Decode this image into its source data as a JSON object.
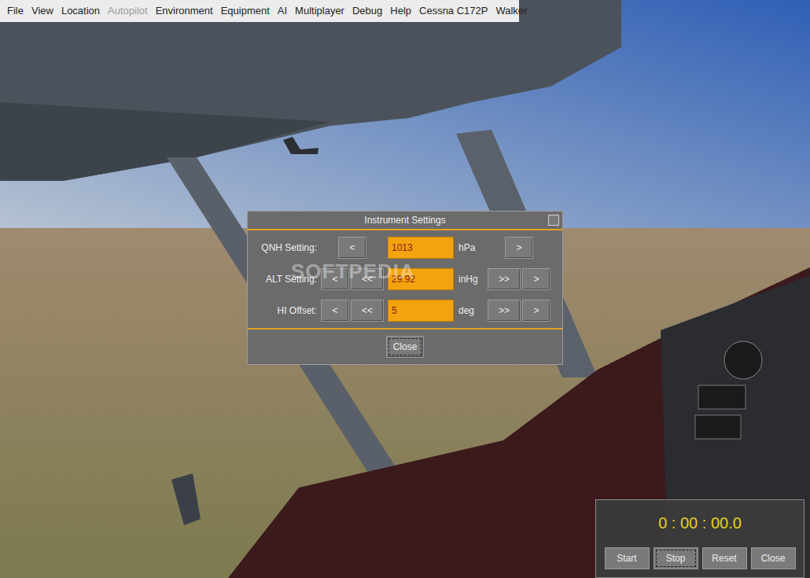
{
  "menu_bar": {
    "items": [
      {
        "label": "File",
        "disabled": false
      },
      {
        "label": "View",
        "disabled": false
      },
      {
        "label": "Location",
        "disabled": false
      },
      {
        "label": "Autopilot",
        "disabled": true
      },
      {
        "label": "Environment",
        "disabled": false
      },
      {
        "label": "Equipment",
        "disabled": false
      },
      {
        "label": "AI",
        "disabled": false
      },
      {
        "label": "Multiplayer",
        "disabled": false
      },
      {
        "label": "Debug",
        "disabled": false
      },
      {
        "label": "Help",
        "disabled": false
      },
      {
        "label": "Cessna C172P",
        "disabled": false
      },
      {
        "label": "Walker",
        "disabled": false
      }
    ]
  },
  "instrument_dialog": {
    "title": "Instrument Settings",
    "rows": [
      {
        "label": "QNH Setting:",
        "value": "1013",
        "unit": "hPa",
        "left_buttons": [
          "<"
        ],
        "right_buttons": [
          ">"
        ]
      },
      {
        "label": "ALT Setting:",
        "value": "29.92",
        "unit": "inHg",
        "left_buttons": [
          "<",
          "<<"
        ],
        "right_buttons": [
          ">>",
          ">"
        ]
      },
      {
        "label": "HI Offset:",
        "value": "5",
        "unit": "deg",
        "left_buttons": [
          "<",
          "<<"
        ],
        "right_buttons": [
          ">>",
          ">"
        ]
      }
    ],
    "close_button": {
      "label": "Close",
      "focused": true
    }
  },
  "timer": {
    "display": "0 : 00 : 00.0",
    "buttons": [
      {
        "label": "Start",
        "focused": false
      },
      {
        "label": "Stop",
        "focused": true
      },
      {
        "label": "Reset",
        "focused": false
      },
      {
        "label": "Close",
        "focused": false
      }
    ]
  },
  "watermark": "SOFTPEDIA"
}
